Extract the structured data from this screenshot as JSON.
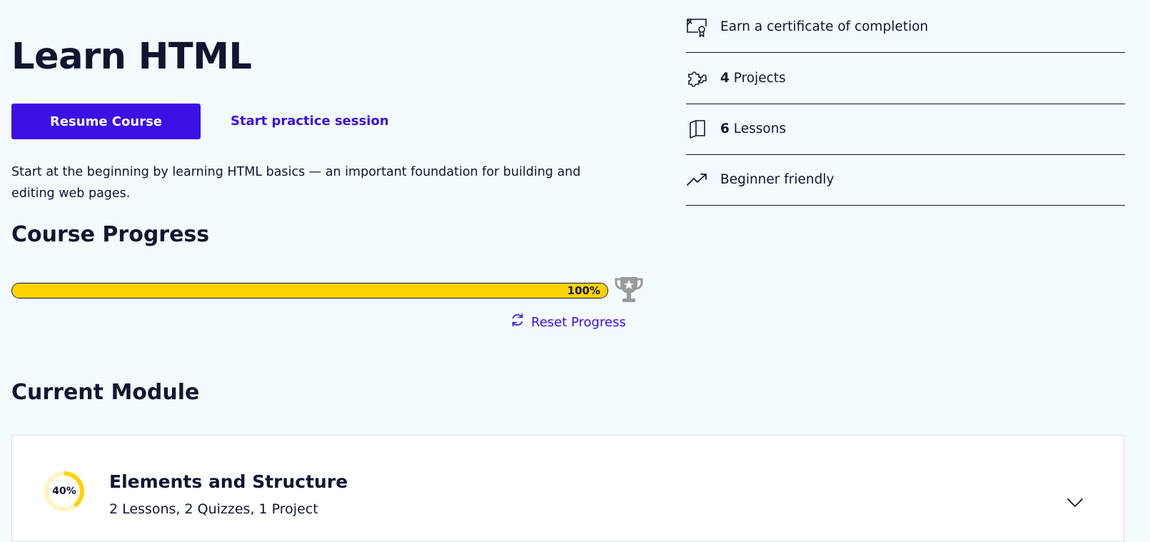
{
  "course": {
    "title": "Learn HTML",
    "resume_label": "Resume Course",
    "practice_label": "Start practice session",
    "description": "Start at the beginning by learning HTML basics — an important foundation for building and editing web pages."
  },
  "progress": {
    "heading": "Course Progress",
    "percent": 100,
    "percent_label": "100%",
    "reset_label": "Reset Progress",
    "icon": "trophy-icon"
  },
  "features": [
    {
      "icon": "certificate-icon",
      "number": "",
      "text": "Earn a certificate of completion"
    },
    {
      "icon": "puzzle-icon",
      "number": "4",
      "text": " Projects"
    },
    {
      "icon": "book-icon",
      "number": "6",
      "text": " Lessons"
    },
    {
      "icon": "trending-up-icon",
      "number": "",
      "text": "Beginner friendly"
    }
  ],
  "current_module": {
    "heading": "Current Module",
    "title": "Elements and Structure",
    "meta": "2 Lessons, 2 Quizzes, 1 Project",
    "percent": 40,
    "percent_label": "40%"
  },
  "colors": {
    "accent": "#3a10e5",
    "progress_fill": "#ffd300",
    "background": "#f3fbff",
    "text": "#10162f"
  }
}
